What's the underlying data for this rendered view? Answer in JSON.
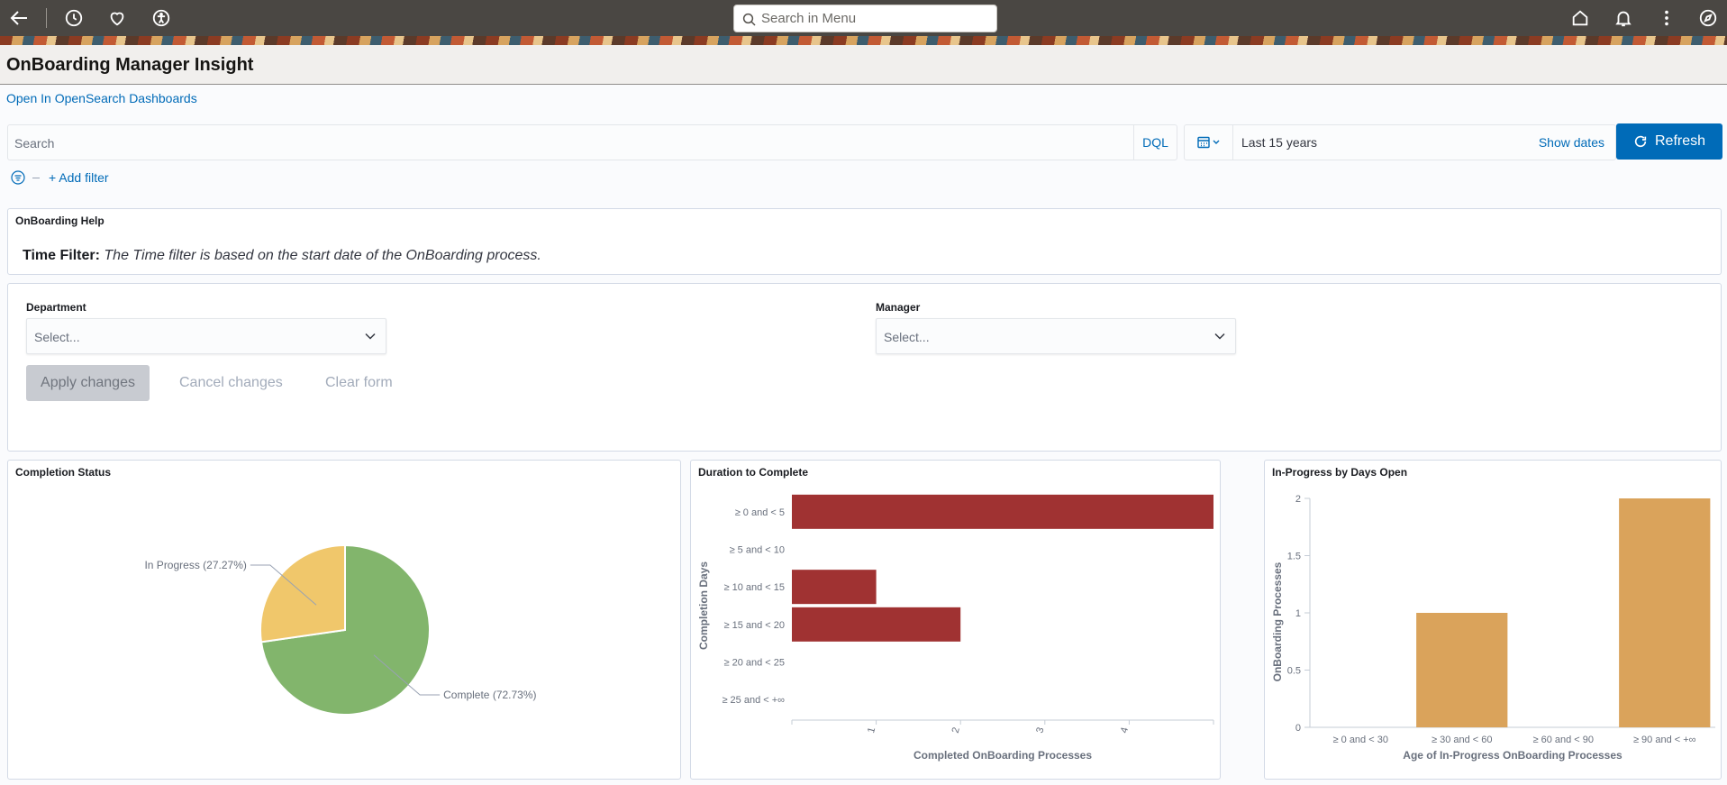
{
  "topbar": {
    "search_placeholder": "Search in Menu",
    "icons": [
      "back-icon",
      "history-icon",
      "favorites-icon",
      "accessibility-icon",
      "home-icon",
      "notifications-icon",
      "more-options-icon",
      "navigator-icon"
    ]
  },
  "page": {
    "title": "OnBoarding Manager Insight",
    "open_link": "Open In OpenSearch Dashboards"
  },
  "query": {
    "placeholder": "Search",
    "dql_label": "DQL",
    "date_range": "Last 15 years",
    "show_dates": "Show dates",
    "refresh_label": "Refresh",
    "add_filter": "+ Add filter"
  },
  "help": {
    "title": "OnBoarding Help",
    "label": "Time Filter:",
    "text": "The Time filter is based on the start date of the OnBoarding process."
  },
  "controls": {
    "department_label": "Department",
    "department_value": "Select...",
    "manager_label": "Manager",
    "manager_value": "Select...",
    "apply_label": "Apply changes",
    "cancel_label": "Cancel changes",
    "clear_label": "Clear form"
  },
  "colors": {
    "accent": "#006bb8",
    "pie_complete": "#82b56c",
    "pie_in_progress": "#f0c76b",
    "bar_duration": "#a03232",
    "bar_days_open": "#daa35b"
  },
  "chart_data": [
    {
      "type": "pie",
      "title": "Completion Status",
      "slices": [
        {
          "label": "Complete (72.73%)",
          "value": 72.73
        },
        {
          "label": "In Progress (27.27%)",
          "value": 27.27
        }
      ]
    },
    {
      "type": "bar",
      "orientation": "horizontal",
      "title": "Duration to Complete",
      "categories": [
        "≥ 0 and < 5",
        "≥ 5 and < 10",
        "≥ 10 and < 15",
        "≥ 15 and < 20",
        "≥ 20 and < 25",
        "≥ 25 and < +∞"
      ],
      "values": [
        5,
        0,
        1,
        2,
        0,
        0
      ],
      "xlabel": "Completed OnBoarding Processes",
      "ylabel": "Completion Days",
      "xticks": [
        "1",
        "2",
        "3",
        "4"
      ],
      "xlim": [
        0,
        5
      ]
    },
    {
      "type": "bar",
      "title": "In-Progress by Days Open",
      "categories": [
        "≥ 0 and < 30",
        "≥ 30 and < 60",
        "≥ 60 and < 90",
        "≥ 90 and < +∞"
      ],
      "values": [
        0,
        1,
        0,
        2
      ],
      "xlabel": "Age of In-Progress OnBoarding Processes",
      "ylabel": "OnBoarding Processes",
      "yticks": [
        "0",
        "0.5",
        "1",
        "1.5",
        "2"
      ],
      "ylim": [
        0,
        2
      ]
    }
  ]
}
